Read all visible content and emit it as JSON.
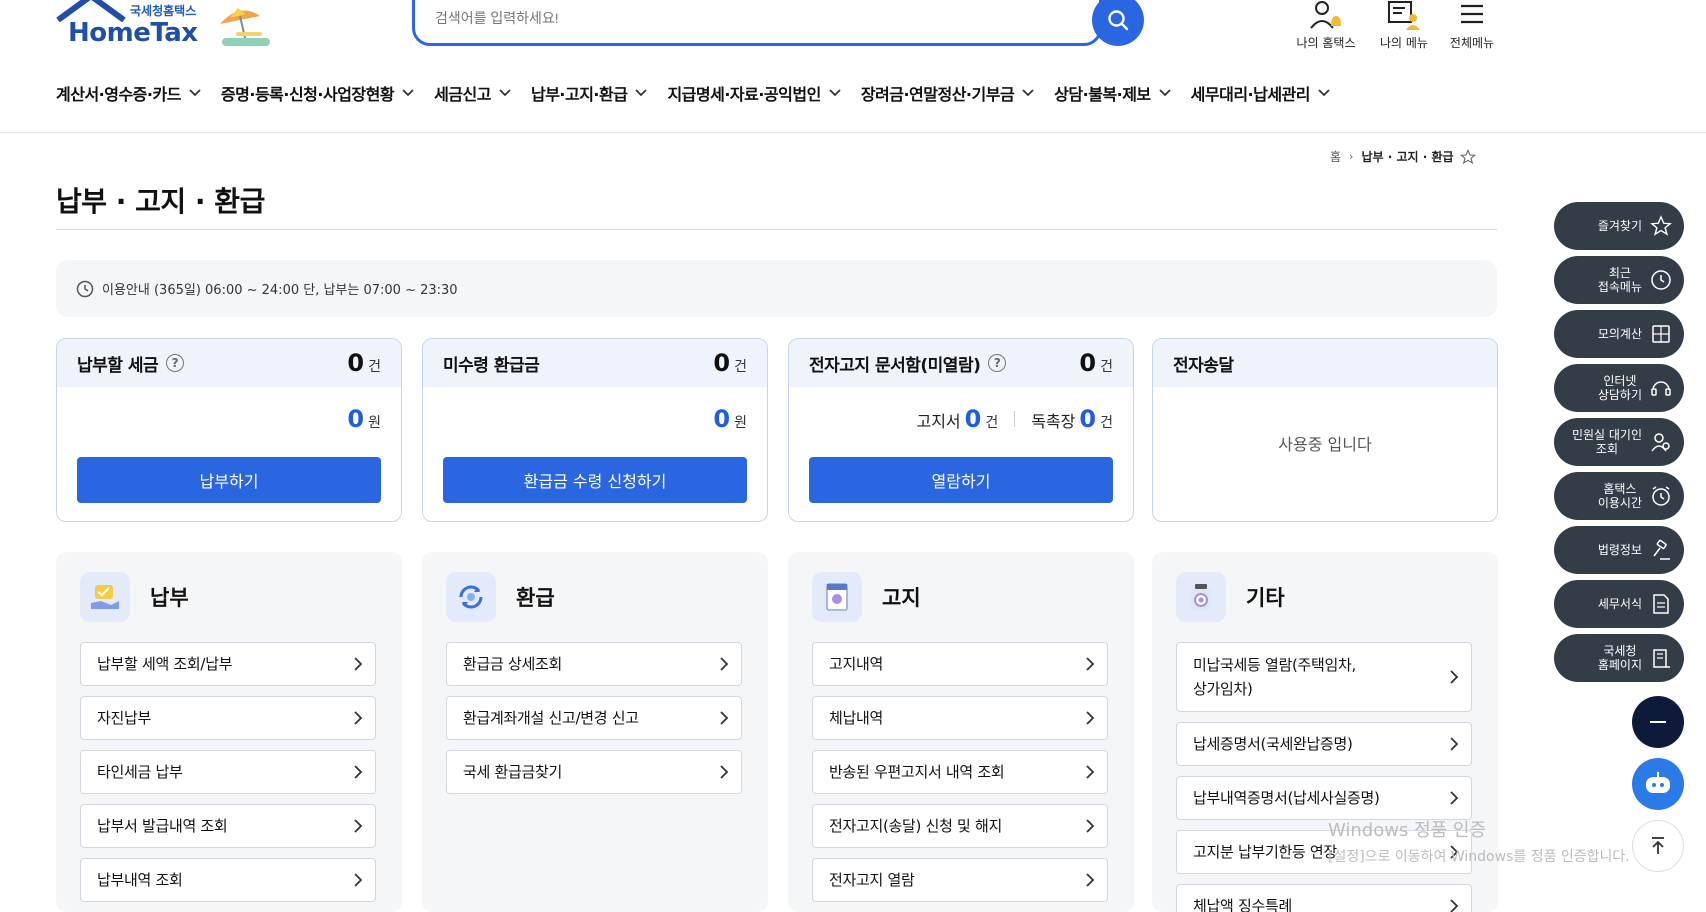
{
  "header": {
    "logo_sub": "국세청홈택스",
    "logo_main": "HomeTax",
    "search_placeholder": "검색어를 입력하세요!",
    "top_icons": [
      {
        "label": "나의 홈택스",
        "icon": "user-bell-icon"
      },
      {
        "label": "나의 메뉴",
        "icon": "my-menu-icon"
      },
      {
        "label": "전체메뉴",
        "icon": "hamburger-icon"
      }
    ]
  },
  "gnb": [
    "계산서·영수증·카드",
    "증명·등록·신청·사업장현황",
    "세금신고",
    "납부·고지·환급",
    "지급명세·자료·공익법인",
    "장려금·연말정산·기부금",
    "상담·불복·제보",
    "세무대리·납세관리"
  ],
  "breadcrumb": {
    "home": "홈",
    "current": "납부 · 고지 · 환급"
  },
  "page_title": "납부 · 고지 · 환급",
  "notice": "이용안내 (365일) 06:00 ~ 24:00 단, 납부는 07:00 ~ 23:30",
  "summary": {
    "card1": {
      "title": "납부할 세금",
      "count": "0",
      "count_unit": "건",
      "amount": "0",
      "amount_unit": "원",
      "button": "납부하기"
    },
    "card2": {
      "title": "미수령 환급금",
      "count": "0",
      "count_unit": "건",
      "amount": "0",
      "amount_unit": "원",
      "button": "환급금 수령 신청하기"
    },
    "card3": {
      "title": "전자고지 문서함(미열람)",
      "count": "0",
      "count_unit": "건",
      "notice_label": "고지서",
      "notice_count": "0",
      "notice_unit": "건",
      "urge_label": "독촉장",
      "urge_count": "0",
      "urge_unit": "건",
      "button": "열람하기"
    },
    "card4": {
      "title": "전자송달",
      "status": "사용중 입니다"
    }
  },
  "categories": {
    "pay": {
      "title": "납부",
      "icon": "payment-hand-icon",
      "items": [
        "납부할 세액 조회/납부",
        "자진납부",
        "타인세금 납부",
        "납부서 발급내역 조회",
        "납부내역 조회"
      ]
    },
    "refund": {
      "title": "환급",
      "icon": "refund-cycle-icon",
      "items": [
        "환급금 상세조회",
        "환급계좌개설 신고/변경 신고",
        "국세 환급금찾기"
      ]
    },
    "notice": {
      "title": "고지",
      "icon": "notice-document-icon",
      "items": [
        "고지내역",
        "체납내역",
        "반송된 우편고지서 내역 조회",
        "전자고지(송달) 신청 및 해지",
        "전자고지 열람"
      ]
    },
    "etc": {
      "title": "기타",
      "icon": "etc-jar-icon",
      "items": [
        "미납국세등 열람(주택임차,\n상가임차)",
        "납세증명서(국세완납증명)",
        "납부내역증명서(납세사실증명)",
        "고지분 납부기한등 연장",
        "체납액 징수특례"
      ]
    }
  },
  "quick_menu": [
    {
      "label": "즐겨찾기",
      "icon": "star-icon"
    },
    {
      "label": "최근\n접속메뉴",
      "icon": "clock-icon"
    },
    {
      "label": "모의계산",
      "icon": "calculator-icon"
    },
    {
      "label": "인터넷\n상담하기",
      "icon": "headset-icon"
    },
    {
      "label": "민원실 대기인\n조회",
      "icon": "person-search-icon"
    },
    {
      "label": "홈택스\n이용시간",
      "icon": "alarm-clock-icon"
    },
    {
      "label": "법령정보",
      "icon": "law-gavel-icon"
    },
    {
      "label": "세무서식",
      "icon": "form-document-icon"
    },
    {
      "label": "국세청\n홈페이지",
      "icon": "building-icon"
    }
  ],
  "watermark": {
    "line1": "Windows 정품 인증",
    "line2": "[설정]으로 이동하여 Windows를 정품 인증합니다."
  },
  "colors": {
    "primary": "#2a66e0",
    "quick_bg": "#333d48",
    "card_head": "#eef3fc",
    "panel_bg": "#f5f6f8"
  }
}
